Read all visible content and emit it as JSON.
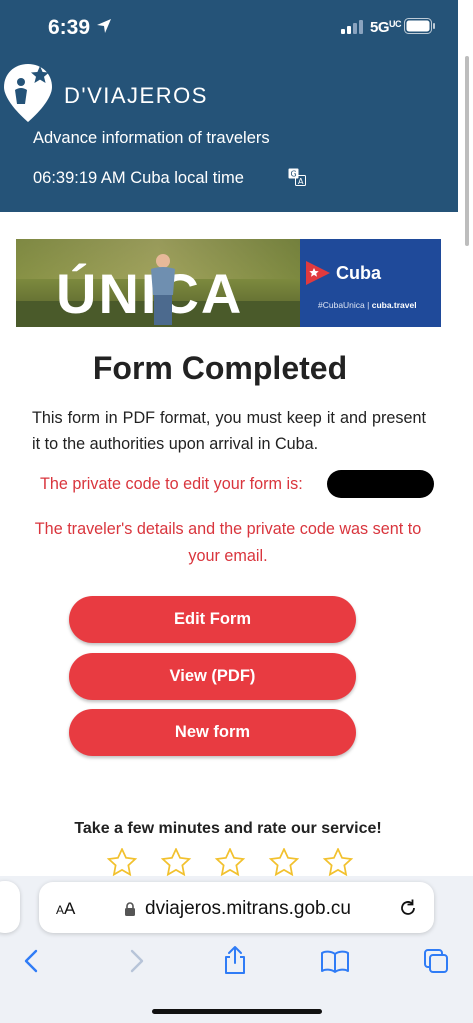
{
  "status_bar": {
    "time": "6:39",
    "network": "5G",
    "network_suffix": "UC"
  },
  "header": {
    "brand": "D'VIAJEROS",
    "subtitle": "Advance information of travelers",
    "local_time": "06:39:19 AM Cuba local time",
    "header_color": "#255378"
  },
  "banner": {
    "title": "ÚNICA",
    "cuba_label": "Cuba",
    "hashtag": "#CubaUnica",
    "site": "cuba.travel"
  },
  "main": {
    "heading": "Form Completed",
    "instructions": "This form in PDF format, you must keep it and present it to the authorities upon arrival in Cuba.",
    "private_code_label": "The private code to edit your form is:",
    "email_notice": "The traveler's details and the private code was sent to your email.",
    "buttons": {
      "edit": "Edit Form",
      "view": "View (PDF)",
      "new": "New form"
    },
    "rate_prompt": "Take a few minutes and rate our service!",
    "star_count": 5,
    "accent_color": "#e83b41"
  },
  "browser": {
    "aa_label": "AA",
    "url": "dviajeros.mitrans.gob.cu"
  }
}
